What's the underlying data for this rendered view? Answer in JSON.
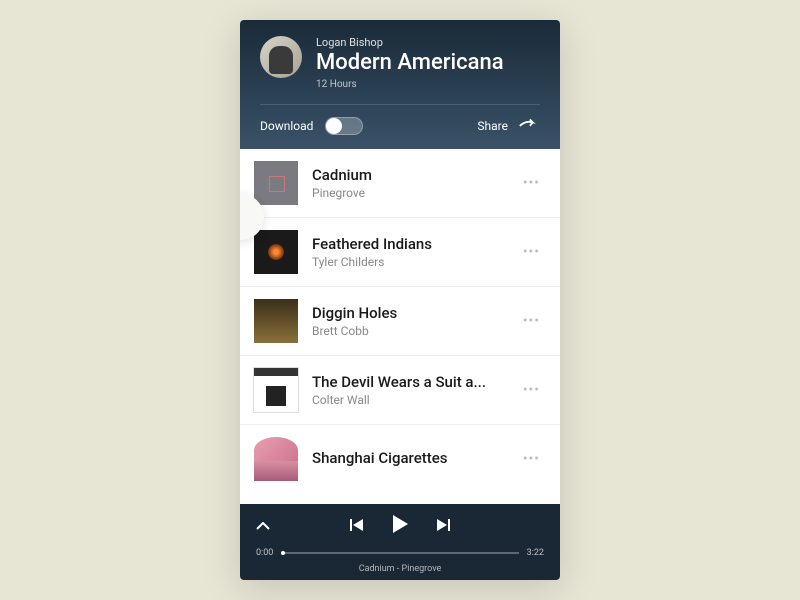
{
  "header": {
    "curator": "Logan Bishop",
    "title": "Modern Americana",
    "duration": "12 Hours",
    "download_label": "Download",
    "share_label": "Share"
  },
  "tracks": [
    {
      "title": "Cadnium",
      "artist": "Pinegrove"
    },
    {
      "title": "Feathered Indians",
      "artist": "Tyler Childers"
    },
    {
      "title": "Diggin Holes",
      "artist": "Brett Cobb"
    },
    {
      "title": "The Devil Wears a Suit a...",
      "artist": "Colter Wall"
    },
    {
      "title": "Shanghai Cigarettes",
      "artist": ""
    }
  ],
  "player": {
    "elapsed": "0:00",
    "total": "3:22",
    "now_playing": "Cadnium - Pinegrove"
  }
}
